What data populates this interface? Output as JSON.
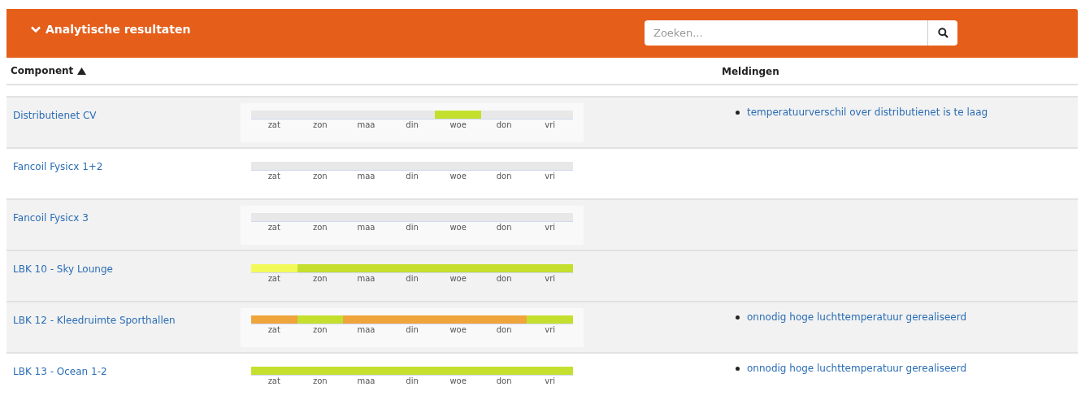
{
  "panel": {
    "title": "Analytische resultaten",
    "expanded": true,
    "search": {
      "placeholder": "Zoeken..."
    }
  },
  "table": {
    "columns": [
      {
        "label": "Component",
        "sorted": true
      },
      {
        "label": "Meldingen",
        "sorted": false
      }
    ],
    "rows": [
      {
        "component": "Distributienet CV",
        "segments": [
          {
            "day": "zat",
            "color": "#e8e8e8"
          },
          {
            "day": "zon",
            "color": "#e8e8e8"
          },
          {
            "day": "maa",
            "color": "#e8e8e8"
          },
          {
            "day": "din",
            "color": "#e8e8e8"
          },
          {
            "day": "woe",
            "color": "#c5df2e"
          },
          {
            "day": "don",
            "color": "#e8e8e8"
          },
          {
            "day": "vri",
            "color": "#e8e8e8"
          }
        ],
        "notifications": [
          "temperatuurverschil over distributienet is te laag"
        ]
      },
      {
        "component": "Fancoil Fysicx 1+2",
        "segments": [
          {
            "day": "zat",
            "color": "#e8e8e8"
          },
          {
            "day": "zon",
            "color": "#e8e8e8"
          },
          {
            "day": "maa",
            "color": "#e8e8e8"
          },
          {
            "day": "din",
            "color": "#e8e8e8"
          },
          {
            "day": "woe",
            "color": "#e8e8e8"
          },
          {
            "day": "don",
            "color": "#e8e8e8"
          },
          {
            "day": "vri",
            "color": "#e8e8e8"
          }
        ]
      },
      {
        "component": "Fancoil Fysicx 3",
        "segments": [
          {
            "day": "zat",
            "color": "#e8e8e8"
          },
          {
            "day": "zon",
            "color": "#e8e8e8"
          },
          {
            "day": "maa",
            "color": "#e8e8e8"
          },
          {
            "day": "din",
            "color": "#e8e8e8"
          },
          {
            "day": "woe",
            "color": "#e8e8e8"
          },
          {
            "day": "don",
            "color": "#e8e8e8"
          },
          {
            "day": "vri",
            "color": "#e8e8e8"
          }
        ]
      },
      {
        "component": "LBK 10 - Sky Lounge",
        "hovered": true,
        "segments": [
          {
            "day": "zat",
            "color": "#f2fa5a"
          },
          {
            "day": "zon",
            "color": "#c5df2e"
          },
          {
            "day": "maa",
            "color": "#c5df2e"
          },
          {
            "day": "din",
            "color": "#c5df2e"
          },
          {
            "day": "woe",
            "color": "#c5df2e"
          },
          {
            "day": "don",
            "color": "#c5df2e"
          },
          {
            "day": "vri",
            "color": "#c5df2e"
          }
        ]
      },
      {
        "component": "LBK 12 - Kleedruimte Sporthallen",
        "segments": [
          {
            "day": "zat",
            "color": "#f0a43c"
          },
          {
            "day": "zon",
            "color": "#c5df2e"
          },
          {
            "day": "maa",
            "color": "#f0a43c"
          },
          {
            "day": "din",
            "color": "#f0a43c"
          },
          {
            "day": "woe",
            "color": "#f0a43c"
          },
          {
            "day": "don",
            "color": "#f0a43c"
          },
          {
            "day": "vri",
            "color": "#c5df2e"
          }
        ],
        "notifications": [
          "onnodig hoge luchttemperatuur gerealiseerd"
        ]
      },
      {
        "component": "LBK 13 - Ocean 1-2",
        "segments": [
          {
            "day": "zat",
            "color": "#c5df2e"
          },
          {
            "day": "zon",
            "color": "#c5df2e"
          },
          {
            "day": "maa",
            "color": "#c5df2e"
          },
          {
            "day": "din",
            "color": "#c5df2e"
          },
          {
            "day": "woe",
            "color": "#c5df2e"
          },
          {
            "day": "don",
            "color": "#c5df2e"
          },
          {
            "day": "vri",
            "color": "#c5df2e"
          }
        ],
        "notifications": [
          "onnodig hoge luchttemperatuur gerealiseerd"
        ]
      }
    ]
  }
}
